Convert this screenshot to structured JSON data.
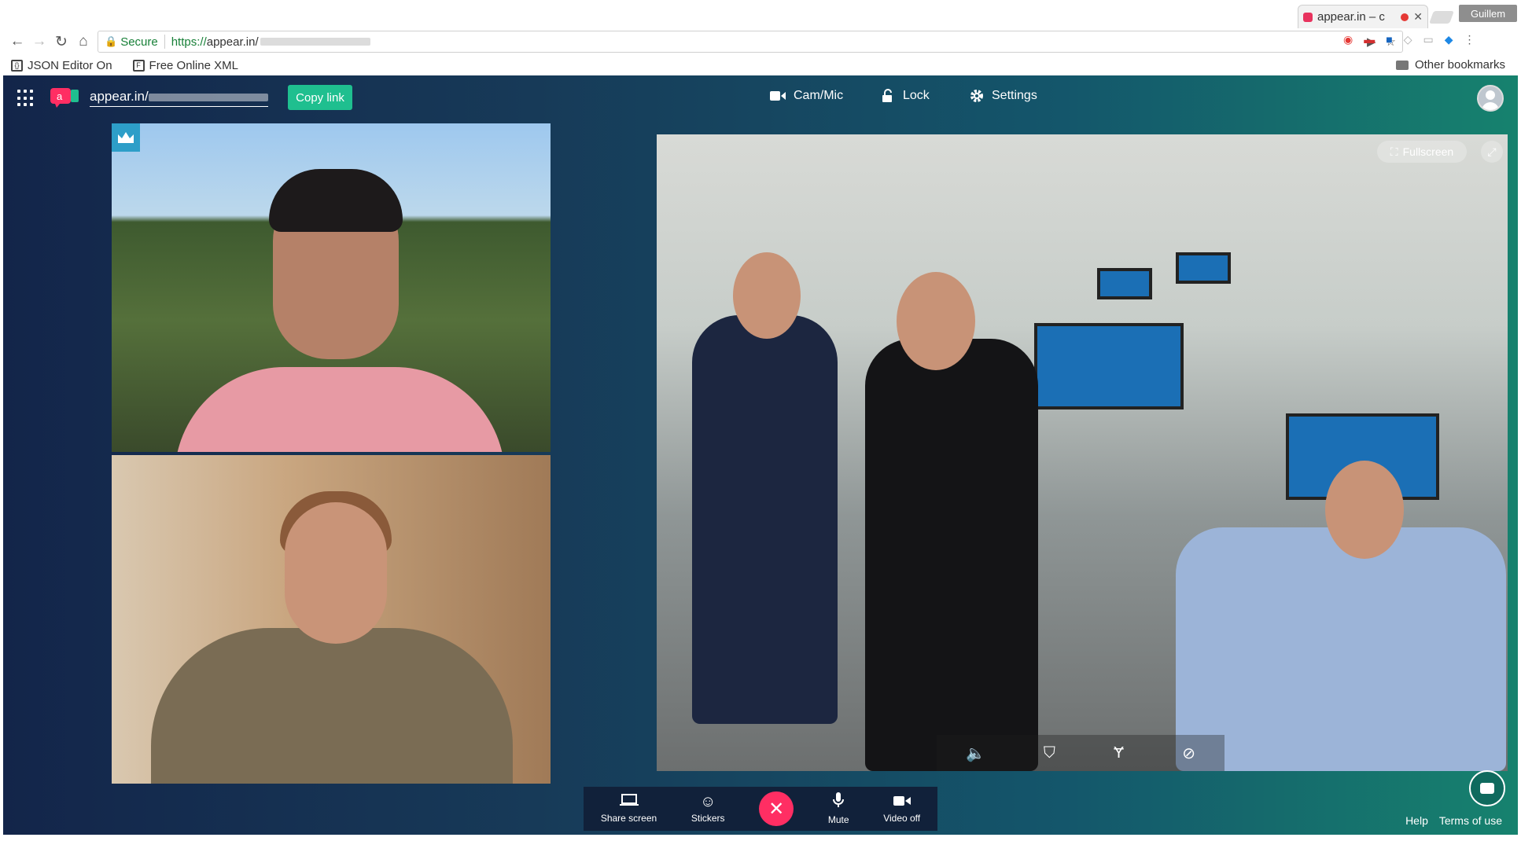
{
  "browser": {
    "tab_title": "appear.in – c",
    "profile_name": "Guillem",
    "secure_label": "Secure",
    "url_scheme": "https://",
    "url_host": "appear.in/",
    "bookmarks": [
      "JSON Editor On",
      "Free Online XML"
    ],
    "other_bookmarks": "Other bookmarks"
  },
  "header": {
    "room_prefix": "appear.in/",
    "copy_link": "Copy link",
    "cam_mic": "Cam/Mic",
    "lock": "Lock",
    "settings": "Settings"
  },
  "videos": {
    "fullscreen": "Fullscreen"
  },
  "bottom_bar": {
    "share_screen": "Share screen",
    "stickers": "Stickers",
    "mute": "Mute",
    "video_off": "Video off"
  },
  "footer": {
    "help": "Help",
    "terms": "Terms of use"
  },
  "colors": {
    "accent_green": "#1fbf8f",
    "leave_red": "#ff2e63",
    "crown_blue": "#2d9ec8"
  }
}
